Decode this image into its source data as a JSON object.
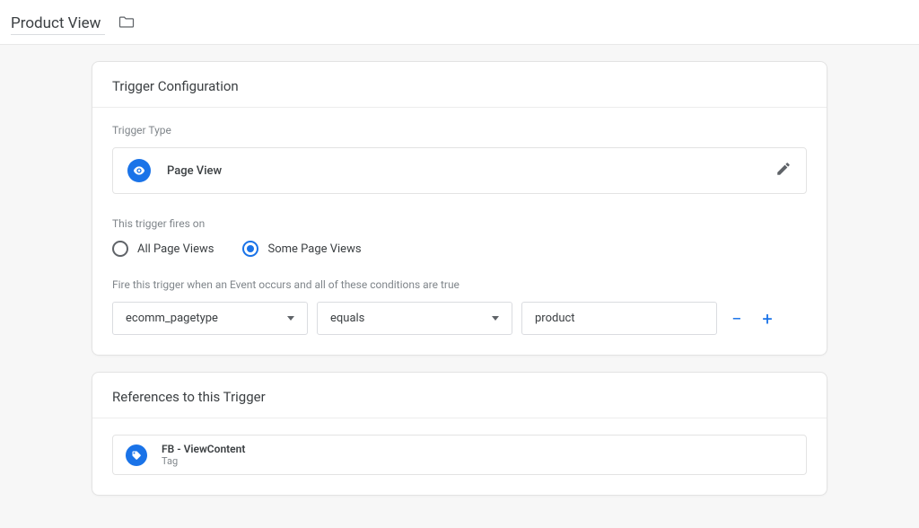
{
  "header": {
    "title": "Product View"
  },
  "config": {
    "card_title": "Trigger Configuration",
    "trigger_type_label": "Trigger Type",
    "trigger_type_name": "Page View",
    "fires_on_label": "This trigger fires on",
    "radio_all": "All Page Views",
    "radio_some": "Some Page Views",
    "conditions_label": "Fire this trigger when an Event occurs and all of these conditions are true",
    "condition": {
      "variable": "ecomm_pagetype",
      "operator": "equals",
      "value": "product"
    }
  },
  "references": {
    "card_title": "References to this Trigger",
    "items": [
      {
        "name": "FB - ViewContent",
        "type": "Tag"
      }
    ]
  }
}
